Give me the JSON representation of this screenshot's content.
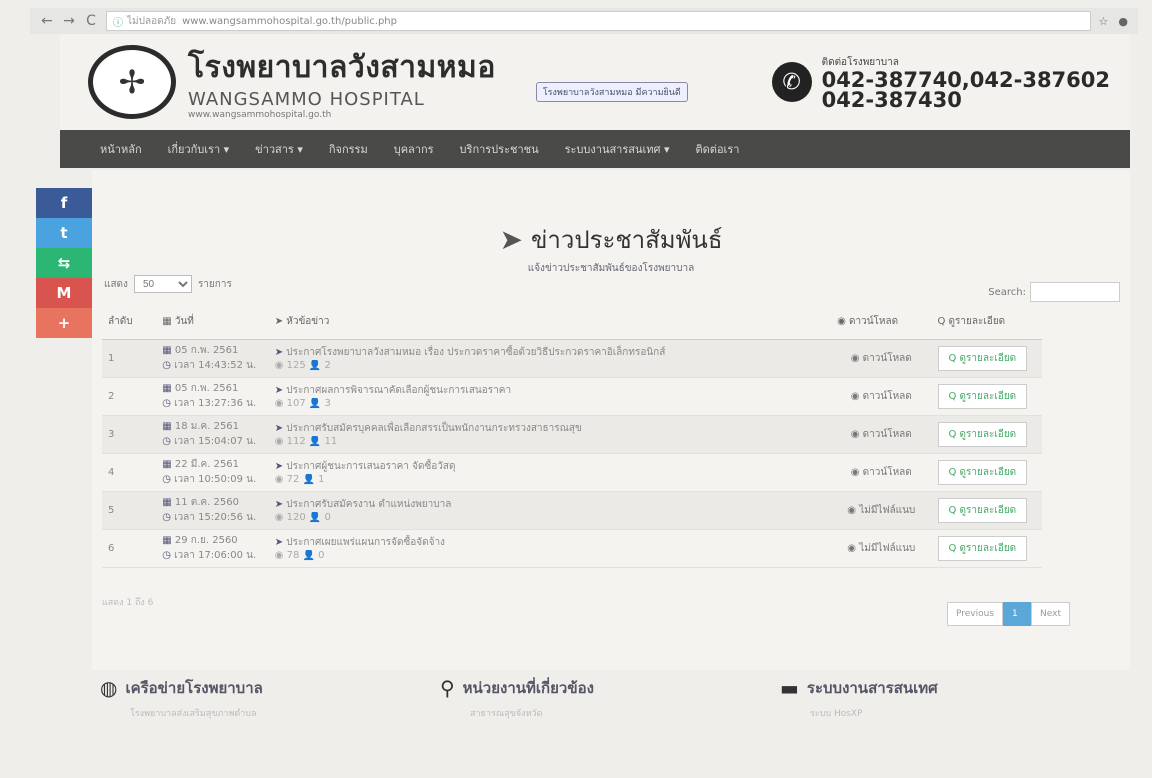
{
  "browser": {
    "back": "←",
    "forward": "→",
    "reload": "C",
    "site_label": "ไม่ปลอดภัย",
    "url": "www.wangsammohospital.go.th/public.php",
    "star": "☆"
  },
  "header": {
    "brand_th": "โรงพยาบาลวังสามหมอ",
    "brand_en": "WANGSAMMO HOSPITAL",
    "brand_url": "www.wangsammohospital.go.th",
    "mid_link": "โรงพยาบาลวังสามหมอ มีความยินดี",
    "contact_label": "ติดต่อโรงพยาบาล",
    "phone1": "042-387740,042-387602",
    "phone2": "042-387430"
  },
  "navbar": {
    "items": [
      "หน้าหลัก",
      "เกี่ยวกับเรา ▾",
      "ข่าวสาร ▾",
      "กิจกรรม",
      "บุคลากร",
      "บริการประชาชน",
      "ระบบงานสารสนเทศ ▾",
      "ติดต่อเรา"
    ]
  },
  "social": [
    {
      "icon": "f",
      "color": "#3b5a98"
    },
    {
      "icon": "t",
      "color": "#4aa3df"
    },
    {
      "icon": "⇆",
      "color": "#2bb673"
    },
    {
      "icon": "M",
      "color": "#d9534f"
    },
    {
      "icon": "+",
      "color": "#e8735e"
    }
  ],
  "main": {
    "title": "ข่าวประชาสัมพันธ์",
    "subtitle": "แจ้งข่าวประชาสัมพันธ์ของโรงพยาบาล",
    "show_label": "แสดง",
    "entries_value": "50",
    "entries_suffix": "รายการ",
    "search_label": "Search:"
  },
  "table": {
    "headers": {
      "no": "ลำดับ",
      "date": "▦ วันที่",
      "topic": "➤ หัวข้อข่าว",
      "status": "◉ ดาวน์โหลด",
      "view": "Q ดูรายละเอียด"
    },
    "rows": [
      {
        "no": "1",
        "date": "05 ก.พ. 2561",
        "time": "เวลา 14:43:52 น.",
        "topic": "ประกาศโรงพยาบาลวังสามหมอ เรื่อง ประกวดราคาซื้อด้วยวิธีประกวดราคาอิเล็กทรอนิกส์",
        "meta": "◉ 125 👤 2",
        "status": "◉ ดาวน์โหลด",
        "view": "Q ดูรายละเอียด"
      },
      {
        "no": "2",
        "date": "05 ก.พ. 2561",
        "time": "เวลา 13:27:36 น.",
        "topic": "ประกาศผลการพิจารณาคัดเลือกผู้ชนะการเสนอราคา",
        "meta": "◉ 107 👤 3",
        "status": "◉ ดาวน์โหลด",
        "view": "Q ดูรายละเอียด"
      },
      {
        "no": "3",
        "date": "18 ม.ค. 2561",
        "time": "เวลา 15:04:07 น.",
        "topic": "ประกาศรับสมัครบุคคลเพื่อเลือกสรรเป็นพนักงานกระทรวงสาธารณสุข",
        "meta": "◉ 112 👤 11",
        "status": "◉ ดาวน์โหลด",
        "view": "Q ดูรายละเอียด"
      },
      {
        "no": "4",
        "date": "22 มี.ค. 2561",
        "time": "เวลา 10:50:09 น.",
        "topic": "ประกาศผู้ชนะการเสนอราคา จัดซื้อวัสดุ",
        "meta": "◉ 72 👤 1",
        "status": "◉ ดาวน์โหลด",
        "view": "Q ดูรายละเอียด"
      },
      {
        "no": "5",
        "date": "11 ต.ค. 2560",
        "time": "เวลา 15:20:56 น.",
        "topic": "ประกาศรับสมัครงาน ตำแหน่งพยาบาล",
        "meta": "◉ 120 👤 0",
        "status": "◉ ไม่มีไฟล์แนบ",
        "view": "Q ดูรายละเอียด"
      },
      {
        "no": "6",
        "date": "29 ก.ย. 2560",
        "time": "เวลา 17:06:00 น.",
        "topic": "ประกาศเผยแพร่แผนการจัดซื้อจัดจ้าง",
        "meta": "◉ 78 👤 0",
        "status": "◉ ไม่มีไฟล์แนบ",
        "view": "Q ดูรายละเอียด"
      }
    ]
  },
  "pager": {
    "prev": "Previous",
    "current": "1",
    "next": "Next",
    "info": "แสดง 1 ถึง 6"
  },
  "footer": {
    "col1_icon": "◍",
    "col1": "เครือข่ายโรงพยาบาล",
    "col1_sub": "โรงพยาบาลส่งเสริมสุขภาพตำบล",
    "col2_icon": "⚲",
    "col2": "หน่วยงานที่เกี่ยวข้อง",
    "col2_sub": "สาธารณสุขจังหวัด",
    "col3_icon": "▬",
    "col3": "ระบบงานสารสนเทศ",
    "col3_sub": "ระบบ HosXP"
  }
}
